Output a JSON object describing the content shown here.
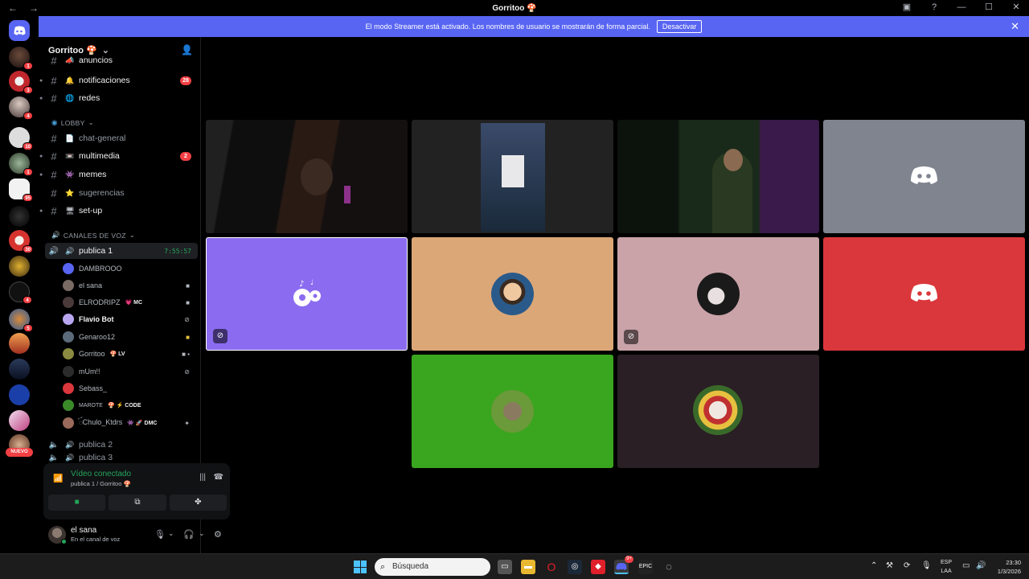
{
  "window": {
    "title": "Gorritoo 🍄",
    "nav_back": "←",
    "nav_forward": "→"
  },
  "banner": {
    "text": "El modo Streamer está activado. Los nombres de usuario se mostrarán de forma parcial.",
    "button": "Desactivar",
    "close": "✕"
  },
  "rail": {
    "badges": [
      "1",
      "3",
      "4",
      "10",
      "1",
      "95",
      "30",
      "4",
      "5"
    ],
    "new_label": "NUEVO"
  },
  "server": {
    "name": "Gorritoo 🍄",
    "channels_top": [
      {
        "emoji": "📣",
        "name": "anuncios"
      },
      {
        "emoji": "🔔",
        "name": "notificaciones",
        "count": "28"
      },
      {
        "emoji": "🌐",
        "name": "redes"
      }
    ],
    "lobby_label": "LOBBY",
    "lobby_channels": [
      {
        "emoji": "📄",
        "name": "chat-general"
      },
      {
        "emoji": "📼",
        "name": "multimedia",
        "count": "2"
      },
      {
        "emoji": "👾",
        "name": "memes"
      },
      {
        "emoji": "⭐",
        "name": "sugerencias"
      },
      {
        "emoji": "🖥",
        "name": "set-up"
      }
    ],
    "voice_label": "CANALES DE VOZ",
    "voice_active": {
      "name": "publica 1",
      "timer": "7:55:57"
    },
    "voice_users": [
      {
        "name": "DAMBROOO",
        "tag": ""
      },
      {
        "name": "el sana",
        "tag": ""
      },
      {
        "name": "ELRODRIPZ",
        "tag": "💗 MC"
      },
      {
        "name": "Flavio Bot",
        "tag": ""
      },
      {
        "name": "Genaroo12",
        "tag": ""
      },
      {
        "name": "Gorritoo",
        "tag": "🍄 LV"
      },
      {
        "name": "mUm!!",
        "tag": ""
      },
      {
        "name": "Sebass_",
        "tag": ""
      },
      {
        "name": "MAROTE",
        "tag": "🍄 ⚡ CODE"
      },
      {
        "name": "ꪾChulo_Ktdrs",
        "tag": "👾 🚀 DMC"
      }
    ],
    "voice_other": [
      "publica 2",
      "publica 3"
    ]
  },
  "voice_panel": {
    "status": "Vídeo conectado",
    "sub": "publica 1 / Gorritoo 🍄"
  },
  "user_panel": {
    "name": "el sana",
    "status": "En el canal de voz"
  },
  "taskbar": {
    "search_placeholder": "Búsqueda",
    "lang_1": "ESP",
    "lang_2": "LAA",
    "time": "23:30",
    "date": "1/3/2026",
    "discord_badge": "9+"
  },
  "colors": {
    "blurple": "#5865f2",
    "green": "#23a55a",
    "red": "#f23f43",
    "tile_grey": "#80848e",
    "tile_purple": "#8b6cf0",
    "tile_peach": "#dca777",
    "tile_pink": "#c9a3a8",
    "tile_red": "#da373c",
    "tile_green": "#3aa51e",
    "tile_dark": "#2a1f24"
  }
}
